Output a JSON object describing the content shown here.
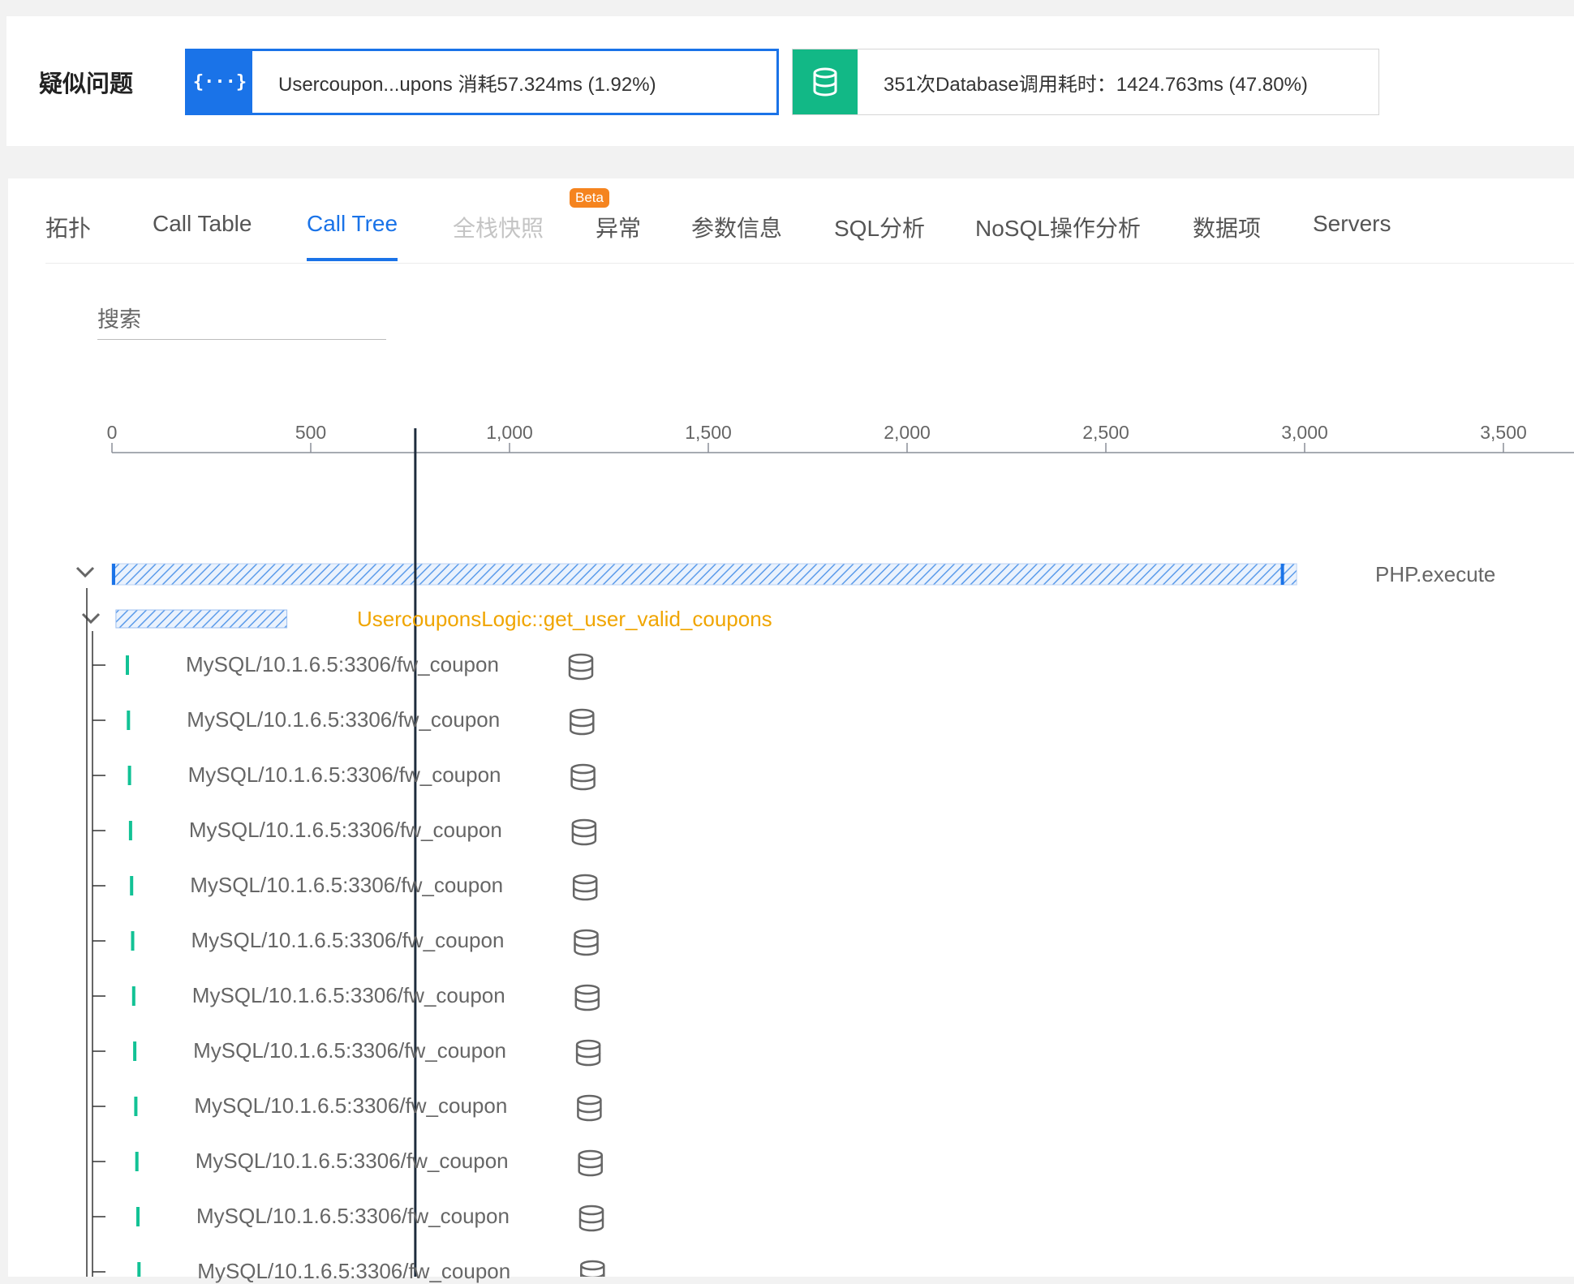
{
  "issues": {
    "title": "疑似问题",
    "cards": [
      {
        "icon": "code-braces-icon",
        "icon_glyph": "{···}",
        "icon_color": "#1a73e8",
        "text": "Usercoupon...upons 消耗57.324ms (1.92%)",
        "active": true
      },
      {
        "icon": "database-icon",
        "icon_color": "#12b886",
        "text": "351次Database调用耗时：1424.763ms (47.80%)",
        "active": false
      }
    ]
  },
  "tabs": {
    "items": [
      {
        "label": "拓扑"
      },
      {
        "label": "Call Table"
      },
      {
        "label": "Call Tree"
      },
      {
        "label": "全栈快照"
      },
      {
        "label": "异常"
      },
      {
        "label": "参数信息"
      },
      {
        "label": "SQL分析"
      },
      {
        "label": "NoSQL操作分析"
      },
      {
        "label": "数据项"
      },
      {
        "label": "Servers"
      }
    ],
    "active_index": 2,
    "disabled_index": 3,
    "beta_badge": "Beta"
  },
  "search": {
    "placeholder": "搜索"
  },
  "axis": {
    "ticks": [
      "0",
      "500",
      "1,000",
      "1,500",
      "2,000",
      "2,500",
      "3,000",
      "3,500"
    ],
    "unit_per_tick": 500,
    "cursor_value": 763
  },
  "tree": {
    "root": {
      "label": "PHP.execute",
      "start": 0,
      "end": 2980
    },
    "logic": {
      "label": "UsercouponsLogic::get_user_valid_coupons",
      "start": 10,
      "end": 440
    },
    "sql_rows": [
      {
        "label": "MySQL/10.1.6.5:3306/fw_coupon",
        "start": 15
      },
      {
        "label": "MySQL/10.1.6.5:3306/fw_coupon",
        "start": 20
      },
      {
        "label": "MySQL/10.1.6.5:3306/fw_coupon",
        "start": 22
      },
      {
        "label": "MySQL/10.1.6.5:3306/fw_coupon",
        "start": 25
      },
      {
        "label": "MySQL/10.1.6.5:3306/fw_coupon",
        "start": 30
      },
      {
        "label": "MySQL/10.1.6.5:3306/fw_coupon",
        "start": 32
      },
      {
        "label": "MySQL/10.1.6.5:3306/fw_coupon",
        "start": 35
      },
      {
        "label": "MySQL/10.1.6.5:3306/fw_coupon",
        "start": 37
      },
      {
        "label": "MySQL/10.1.6.5:3306/fw_coupon",
        "start": 40
      },
      {
        "label": "MySQL/10.1.6.5:3306/fw_coupon",
        "start": 42
      },
      {
        "label": "MySQL/10.1.6.5:3306/fw_coupon",
        "start": 45
      },
      {
        "label": "MySQL/10.1.6.5:3306/fw_coupon",
        "start": 48
      }
    ]
  },
  "colors": {
    "accent": "#1a73e8",
    "sql_bar": "#12c295",
    "logic_text": "#f0a500",
    "cursor": "#1f2d3d"
  }
}
